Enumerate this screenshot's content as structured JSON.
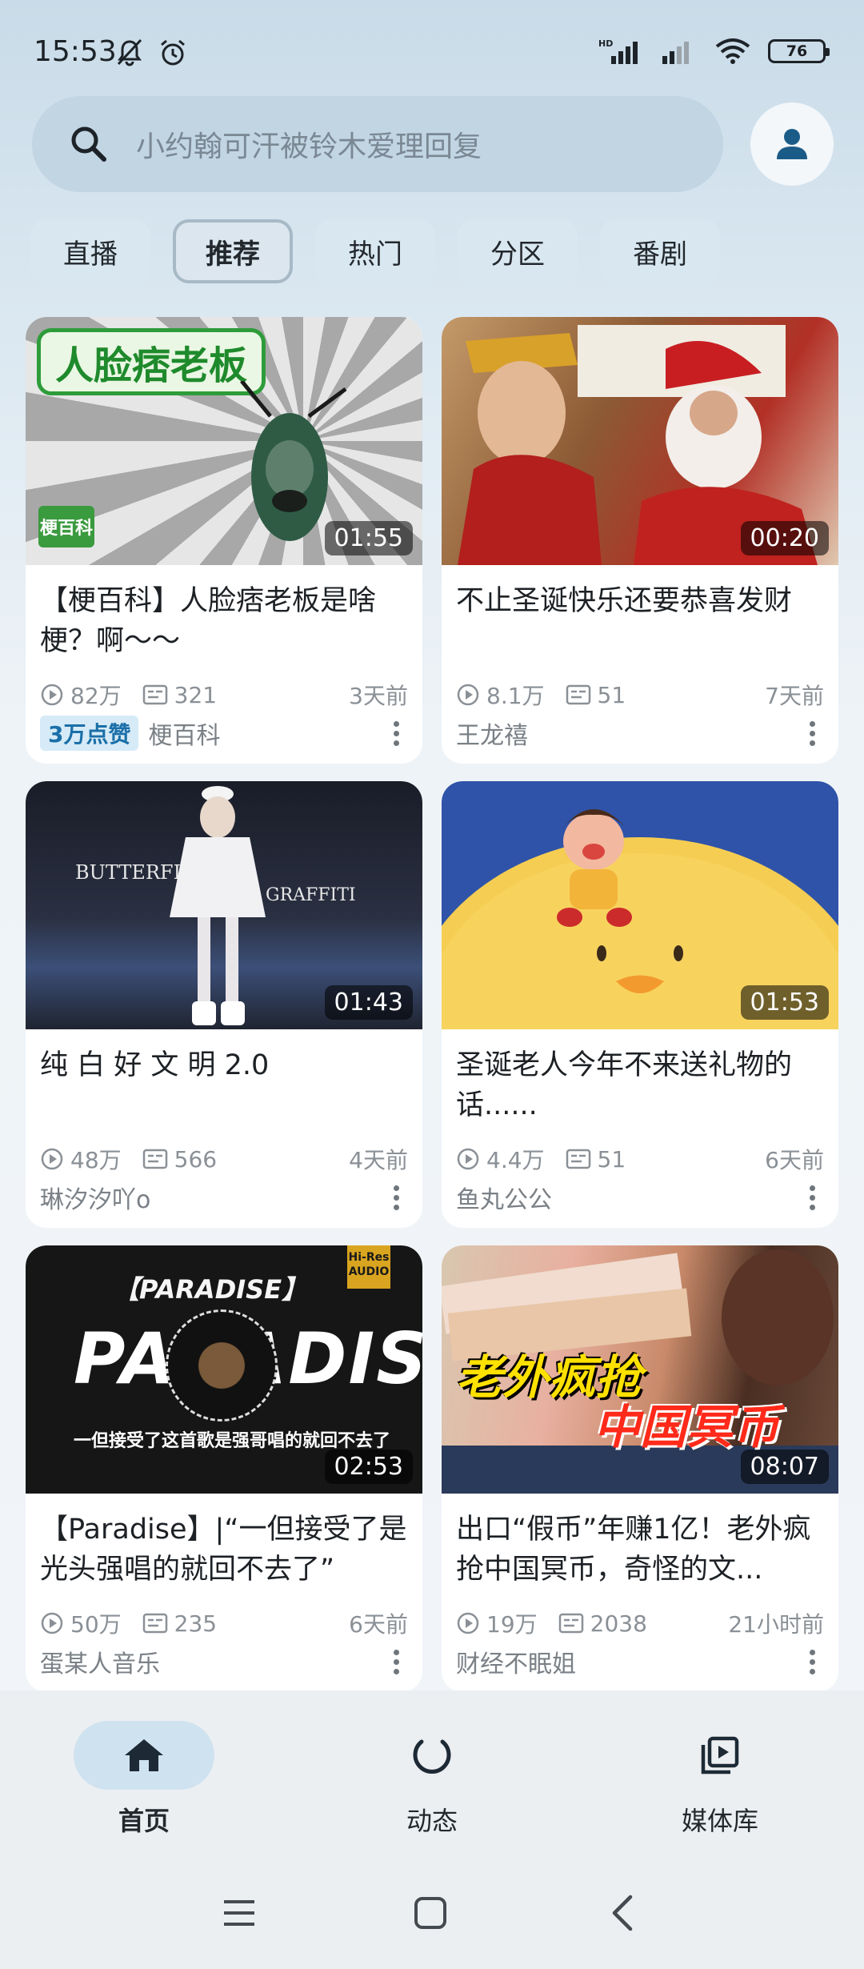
{
  "status": {
    "time": "15:53",
    "battery": "76",
    "network": "HD"
  },
  "search": {
    "placeholder": "小约翰可汗被铃木爱理回复"
  },
  "tabs": [
    {
      "label": "直播",
      "active": false
    },
    {
      "label": "推荐",
      "active": true
    },
    {
      "label": "热门",
      "active": false
    },
    {
      "label": "分区",
      "active": false
    },
    {
      "label": "番剧",
      "active": false
    }
  ],
  "videos": [
    {
      "duration": "01:55",
      "title": "【梗百科】人脸痞老板是啥梗？啊～～",
      "views": "82万",
      "danmaku": "321",
      "ago": "3天前",
      "likes_badge": "3万点赞",
      "author": "梗百科",
      "thumb_text": "人脸痞老板",
      "thumb_logo": "梗百科"
    },
    {
      "duration": "00:20",
      "title": "不止圣诞快乐还要恭喜发财",
      "views": "8.1万",
      "danmaku": "51",
      "ago": "7天前",
      "author": "王龙禧"
    },
    {
      "duration": "01:43",
      "title": "纯 白 好 文 明 2.0",
      "views": "48万",
      "danmaku": "566",
      "ago": "4天前",
      "author": "琳汐汐吖o",
      "thumb_text_left": "BUTTERFLY",
      "thumb_text_right": "GRAFFITI"
    },
    {
      "duration": "01:53",
      "title": "圣诞老人今年不来送礼物的话......",
      "views": "4.4万",
      "danmaku": "51",
      "ago": "6天前",
      "author": "鱼丸公公"
    },
    {
      "duration": "02:53",
      "title": "【Paradise】|“一但接受了是光头强唱的就回不去了”",
      "views": "50万",
      "danmaku": "235",
      "ago": "6天前",
      "author": "蛋某人音乐",
      "thumb_text_top": "【PARADISE】",
      "thumb_text_big": "PARADISE",
      "thumb_text_sub": "一但接受了这首歌是强哥唱的就回不去了",
      "thumb_badge": "Hi-Res AUDIO"
    },
    {
      "duration": "08:07",
      "title": "出口“假币”年赚1亿！老外疯抢中国冥币，奇怪的文...",
      "views": "19万",
      "danmaku": "2038",
      "ago": "21小时前",
      "author": "财经不眠姐",
      "thumb_text_1": "老外疯抢",
      "thumb_text_2": "中国冥币"
    }
  ],
  "bottom_nav": [
    {
      "label": "首页",
      "icon": "home-icon",
      "active": true
    },
    {
      "label": "动态",
      "icon": "activity-icon",
      "active": false
    },
    {
      "label": "媒体库",
      "icon": "library-icon",
      "active": false
    }
  ],
  "colors": {
    "accent": "#1b6fa8",
    "background": "#dbe8f1"
  }
}
